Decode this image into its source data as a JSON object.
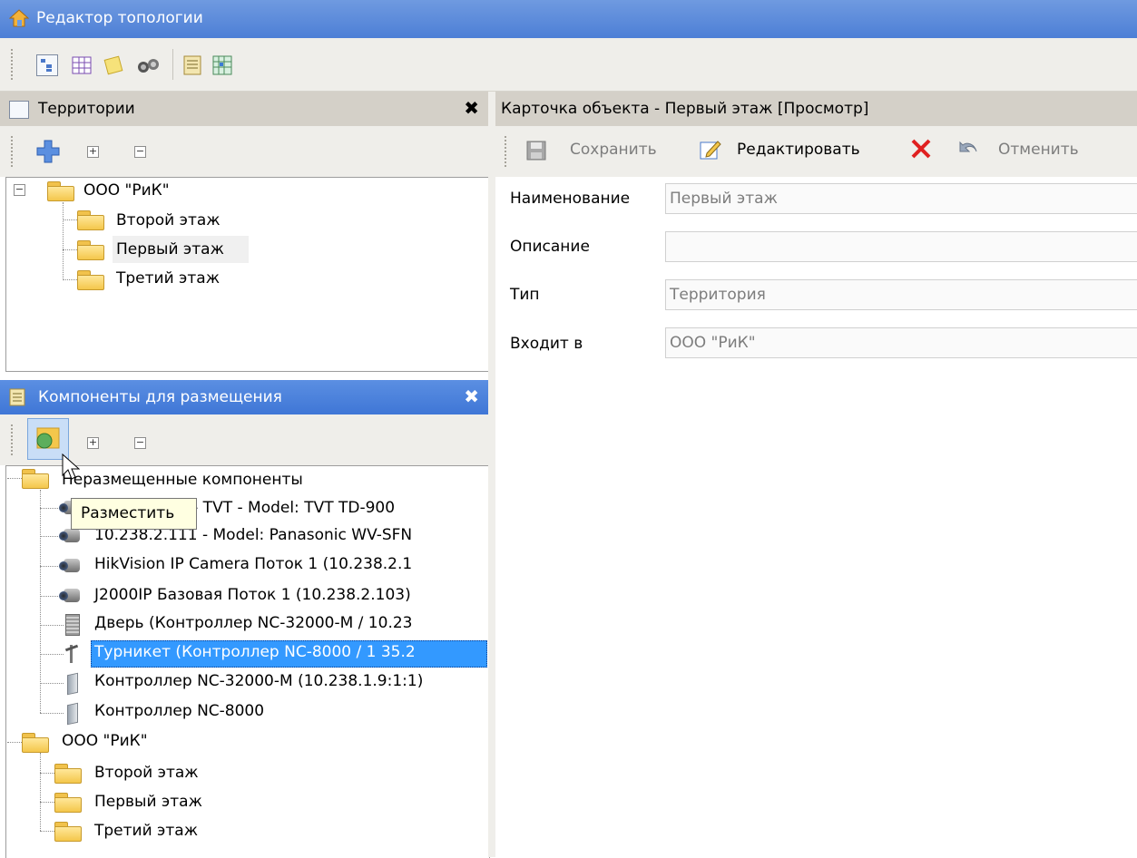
{
  "window": {
    "title": "Редактор топологии"
  },
  "territories_pane": {
    "title": "Территории",
    "close": "✖",
    "tree": {
      "root": "ООО \"РиК\"",
      "children": [
        "Второй этаж",
        "Первый этаж",
        "Третий этаж"
      ],
      "selected": "Первый этаж"
    }
  },
  "components_pane": {
    "title": "Компоненты для размещения",
    "close": "✖",
    "tooltip": "Разместить",
    "groups": [
      {
        "label": "Неразмещенные компоненты",
        "items": [
          {
            "label": "10.238.1.46 - TVT - Model: TVT TD-900",
            "icon": "camera-icon"
          },
          {
            "label": "10.238.2.111 - Model: Panasonic WV-SFN",
            "icon": "camera-icon"
          },
          {
            "label": "HikVision IP Camera Поток 1 (10.238.2.1",
            "icon": "camera-icon"
          },
          {
            "label": "J2000IP Базовая Поток 1 (10.238.2.103)",
            "icon": "camera-icon"
          },
          {
            "label": "Дверь (Контроллер NC-32000-M / 10.23",
            "icon": "door-icon"
          },
          {
            "label": "Турникет (Контроллер NC-8000 / 1  35.2",
            "icon": "turnstile-icon"
          },
          {
            "label": "Контроллер NC-32000-M (10.238.1.9:1:1)",
            "icon": "controller-icon"
          },
          {
            "label": "Контроллер NC-8000",
            "icon": "controller-icon"
          }
        ]
      },
      {
        "label": "ООО \"РиК\"",
        "items": [
          {
            "label": "Второй этаж",
            "icon": "folder-icon"
          },
          {
            "label": "Первый этаж",
            "icon": "folder-icon"
          },
          {
            "label": "Третий этаж",
            "icon": "folder-icon"
          }
        ]
      }
    ],
    "selected": "Турникет (Контроллер NC-8000 / 1  35.2"
  },
  "object_card": {
    "title": "Карточка объекта - Первый этаж [Просмотр]",
    "toolbar": {
      "save": "Сохранить",
      "edit": "Редактировать",
      "cancel": "Отменить"
    },
    "fields": {
      "name_label": "Наименование",
      "name_value": "Первый этаж",
      "description_label": "Описание",
      "description_value": "",
      "type_label": "Тип",
      "type_value": "Территория",
      "parent_label": "Входит в",
      "parent_value": "ООО \"РиК\""
    }
  },
  "colors": {
    "title_bar": "#4d7fd6",
    "selection": "#3399ff",
    "delete_icon": "#e02020"
  }
}
